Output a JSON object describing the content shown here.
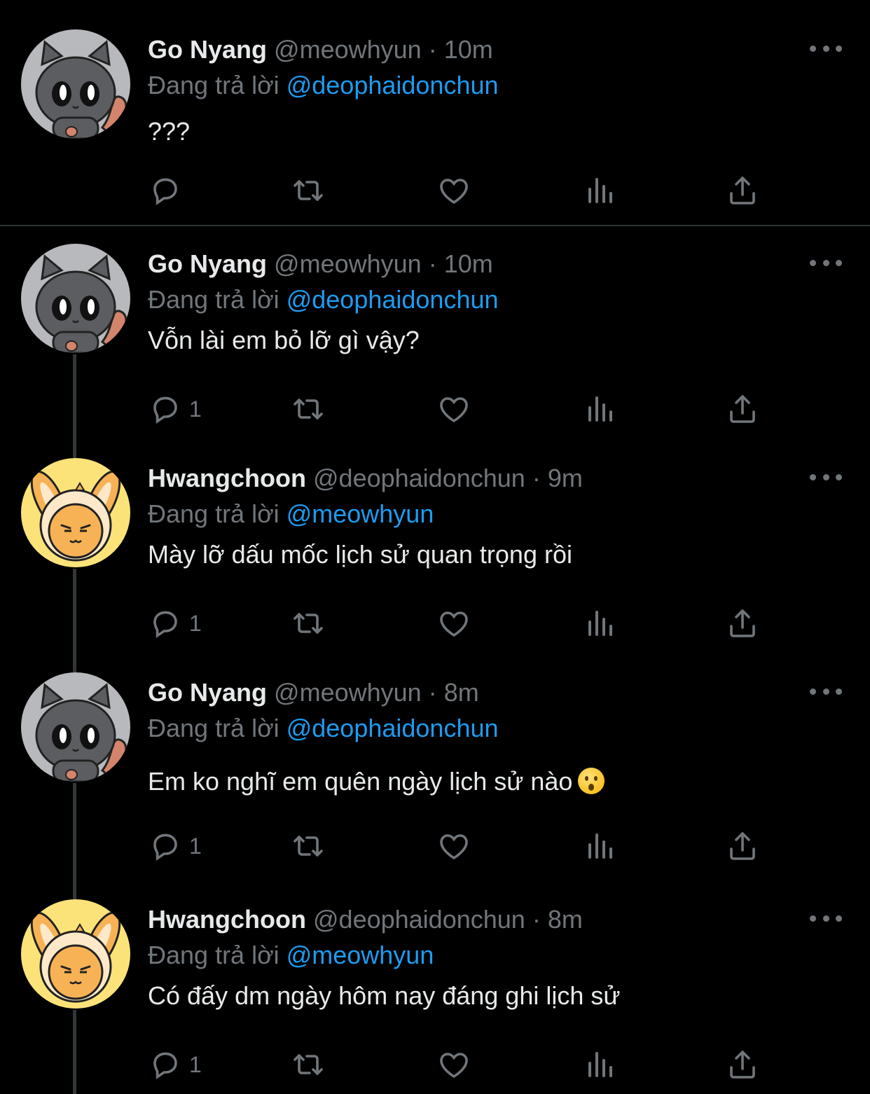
{
  "reply_prefix": "Đang trả lời",
  "tweets": [
    {
      "name": "Go Nyang",
      "handle": "@meowhyun",
      "sep": "·",
      "time": "10m",
      "reply_to": "@deophaidonchun",
      "text": "???",
      "reply_count": "",
      "avatar": "cat"
    },
    {
      "name": "Go Nyang",
      "handle": "@meowhyun",
      "sep": "·",
      "time": "10m",
      "reply_to": "@deophaidonchun",
      "text": "Vỗn lài em bỏ lỡ gì vậy?",
      "reply_count": "1",
      "avatar": "cat"
    },
    {
      "name": "Hwangchoon",
      "handle": "@deophaidonchun",
      "sep": "·",
      "time": "9m",
      "reply_to": "@meowhyun",
      "text": "Mày lỡ dấu mốc lịch sử quan trọng rồi",
      "reply_count": "1",
      "avatar": "bunny"
    },
    {
      "name": "Go Nyang",
      "handle": "@meowhyun",
      "sep": "·",
      "time": "8m",
      "reply_to": "@deophaidonchun",
      "text": "Em ko nghĩ em quên ngày lịch sử nào",
      "emoji": "hushed-face",
      "reply_count": "1",
      "avatar": "cat"
    },
    {
      "name": "Hwangchoon",
      "handle": "@deophaidonchun",
      "sep": "·",
      "time": "8m",
      "reply_to": "@meowhyun",
      "text": "Có đấy dm ngày hôm nay đáng ghi lịch sử",
      "reply_count": "1",
      "avatar": "bunny"
    }
  ],
  "colors": {
    "background": "#000000",
    "text": "#e7e9ea",
    "muted": "#71767b",
    "link": "#1d9bf0",
    "line": "#333639"
  },
  "icons": [
    "reply-icon",
    "retweet-icon",
    "like-icon",
    "views-icon",
    "share-icon",
    "more-icon"
  ]
}
